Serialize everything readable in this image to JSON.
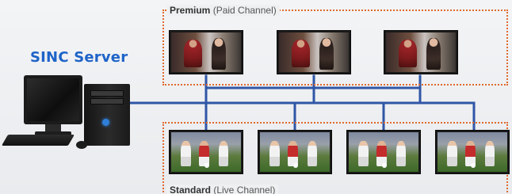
{
  "server": {
    "title": "SINC Server"
  },
  "premium": {
    "label_bold": "Premium",
    "label_rest": " (Paid Channel)",
    "tv_count": 3
  },
  "standard": {
    "label_bold": "Standard",
    "label_rest": "  (Live Channel)",
    "tv_count": 4
  },
  "colors": {
    "network_line": "#2f56a6",
    "group_border": "#e06a2c",
    "title": "#1e64c8"
  },
  "icons": {
    "computer": "desktop-computer-icon",
    "tv": "television-icon"
  }
}
